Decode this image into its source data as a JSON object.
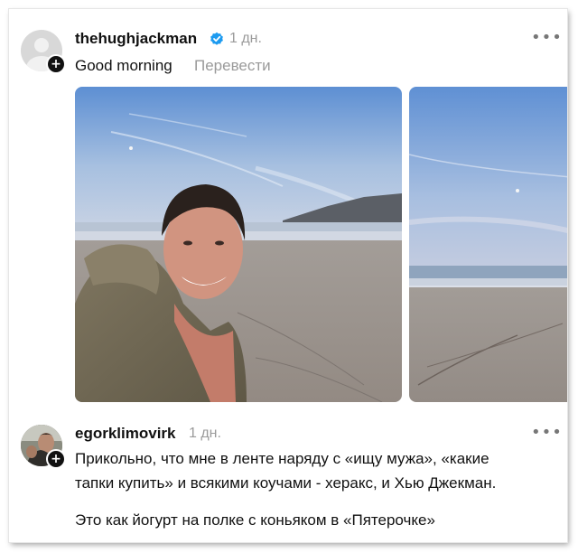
{
  "post": {
    "username": "thehughjackman",
    "time": "1 дн.",
    "caption": "Good morning",
    "translate_label": "Перевести",
    "more_label": "•••"
  },
  "comment": {
    "username": "egorklimovirk",
    "time": "1 дн.",
    "more_label": "•••",
    "line1": "Прикольно, что мне в ленте наряду с «ищу мужа», «какие",
    "line2": "тапки купить» и всякими коучами - херакс, и Хью Джекман.",
    "line3": "Это как йогурт на полке с коньяком в «Пятерочке»"
  },
  "colors": {
    "verified": "#1d9bf0",
    "muted_text": "#9a9a9a"
  },
  "icons": {
    "verified": "verified-badge-icon",
    "follow": "plus-icon",
    "more": "more-icon"
  }
}
